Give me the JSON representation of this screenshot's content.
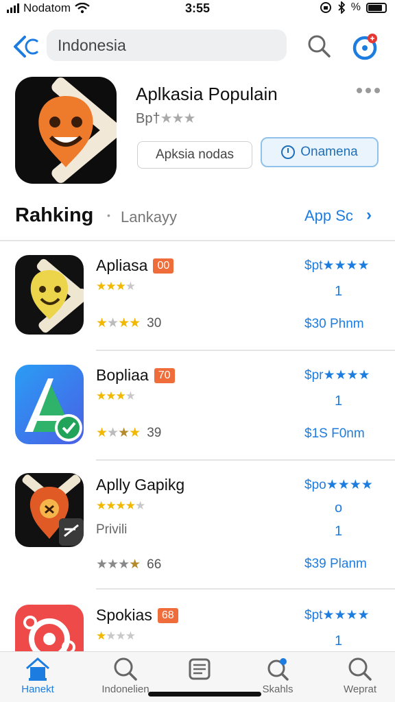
{
  "status_bar": {
    "carrier": "Nodatom",
    "time": "3:55",
    "battery": "%"
  },
  "search": {
    "query": "Indonesia"
  },
  "hero": {
    "title": "Aplkasia Populain",
    "subtitle": "Bp†",
    "subtitle_stars": "★★★",
    "secondary_button": "Apksia nodas",
    "primary_button": "Onamena"
  },
  "ranking": {
    "title": "Rahking",
    "subtitle": "Lankayy",
    "see_all": "App Sc"
  },
  "apps": [
    {
      "name": "Apliasa",
      "rank_badge": "00",
      "stars_on": "★★★",
      "stars_off": "★",
      "rating_count": "30",
      "price_top": "$pt★★★★",
      "rank": "1",
      "price_bottom": "$30 Phnm"
    },
    {
      "name": "Bopliaa",
      "rank_badge": "70",
      "stars_on": "★★★",
      "stars_off": "★",
      "rating_count": "39",
      "price_top": "$pr★★★★",
      "rank": "1",
      "price_bottom": "$1S F0nm"
    },
    {
      "name": "Aplly Gapikg",
      "stars_on": "★★★★",
      "stars_off": "★",
      "extra": "Privili",
      "rating_count": "66",
      "price_top": "$po★★★★",
      "rank_a": "o",
      "rank": "1",
      "price_bottom": "$39 Planm"
    },
    {
      "name": "Spokias",
      "rank_badge": "68",
      "stars_on": "★",
      "stars_off": "★★★",
      "price_top": "$pt★★★★",
      "rank": "1"
    }
  ],
  "tabs": [
    {
      "label": "Hanekt",
      "icon": "house-icon"
    },
    {
      "label": "Indonelien",
      "icon": "search-icon"
    },
    {
      "label": "",
      "icon": "news-icon"
    },
    {
      "label": "Skahls",
      "icon": "refresh-search-icon"
    },
    {
      "label": "Weprat",
      "icon": "search-icon"
    }
  ],
  "colors": {
    "accent": "#1c7ce0",
    "badge": "#ee6d3a",
    "star": "#f2b800"
  }
}
